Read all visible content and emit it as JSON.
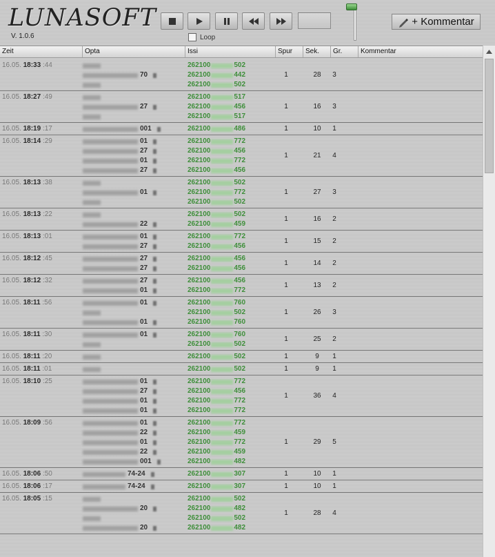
{
  "app": {
    "logo": "LUNASOFT",
    "version": "V. 1.0.6"
  },
  "toolbar": {
    "buttons": [
      {
        "name": "stop-button",
        "icon": "stop-icon"
      },
      {
        "name": "play-button",
        "icon": "play-icon"
      },
      {
        "name": "pause-button",
        "icon": "pause-icon"
      },
      {
        "name": "rewind-button",
        "icon": "rewind-icon"
      },
      {
        "name": "forward-button",
        "icon": "forward-icon"
      }
    ],
    "counter_value": "",
    "loop_label": "Loop",
    "loop_checked": false,
    "volume_level": 0.95,
    "comment_label": "+ Kommentar"
  },
  "table": {
    "columns": [
      "Zeit",
      "Opta",
      "Issi",
      "Spur",
      "Sek.",
      "Gr.",
      "Kommentar"
    ],
    "rows": [
      {
        "date": "16.05.",
        "time": "18:33",
        "sec": ":44",
        "spur": "1",
        "sek": "28",
        "gr": "3",
        "opta": [
          {
            "text": "Luna",
            "suffix": ""
          },
          {
            "text": "",
            "suffix": "70"
          },
          {
            "text": "Luna",
            "suffix": ""
          }
        ],
        "issi": [
          {
            "prefix": "262100",
            "suffix": "502"
          },
          {
            "prefix": "262100",
            "suffix": "442"
          },
          {
            "prefix": "262100",
            "suffix": "502"
          }
        ]
      },
      {
        "date": "16.05.",
        "time": "18:27",
        "sec": ":49",
        "spur": "1",
        "sek": "16",
        "gr": "3",
        "opta": [
          {
            "text": "Luna",
            "suffix": ""
          },
          {
            "text": "",
            "suffix": "27"
          },
          {
            "text": "Luna",
            "suffix": ""
          }
        ],
        "issi": [
          {
            "prefix": "262100",
            "suffix": "517"
          },
          {
            "prefix": "262100",
            "suffix": "456"
          },
          {
            "prefix": "262100",
            "suffix": "517"
          }
        ]
      },
      {
        "date": "16.05.",
        "time": "18:19",
        "sec": ":17",
        "spur": "1",
        "sek": "10",
        "gr": "1",
        "opta": [
          {
            "text": "",
            "suffix": "001"
          }
        ],
        "issi": [
          {
            "prefix": "262100",
            "suffix": "486"
          }
        ]
      },
      {
        "date": "16.05.",
        "time": "18:14",
        "sec": ":29",
        "spur": "1",
        "sek": "21",
        "gr": "4",
        "opta": [
          {
            "text": "",
            "suffix": "01"
          },
          {
            "text": "",
            "suffix": "27"
          },
          {
            "text": "",
            "suffix": "01"
          },
          {
            "text": "",
            "suffix": "27"
          }
        ],
        "issi": [
          {
            "prefix": "262100",
            "suffix": "772"
          },
          {
            "prefix": "262100",
            "suffix": "456"
          },
          {
            "prefix": "262100",
            "suffix": "772"
          },
          {
            "prefix": "262100",
            "suffix": "456"
          }
        ]
      },
      {
        "date": "16.05.",
        "time": "18:13",
        "sec": ":38",
        "spur": "1",
        "sek": "27",
        "gr": "3",
        "opta": [
          {
            "text": "Luna",
            "suffix": ""
          },
          {
            "text": "",
            "suffix": "01"
          },
          {
            "text": "Luna",
            "suffix": ""
          }
        ],
        "issi": [
          {
            "prefix": "262100",
            "suffix": "502"
          },
          {
            "prefix": "262100",
            "suffix": "772"
          },
          {
            "prefix": "262100",
            "suffix": "502"
          }
        ]
      },
      {
        "date": "16.05.",
        "time": "18:13",
        "sec": ":22",
        "spur": "1",
        "sek": "16",
        "gr": "2",
        "opta": [
          {
            "text": "Luna",
            "suffix": ""
          },
          {
            "text": "",
            "suffix": "22"
          }
        ],
        "issi": [
          {
            "prefix": "262100",
            "suffix": "502"
          },
          {
            "prefix": "262100",
            "suffix": "459"
          }
        ]
      },
      {
        "date": "16.05.",
        "time": "18:13",
        "sec": ":01",
        "spur": "1",
        "sek": "15",
        "gr": "2",
        "opta": [
          {
            "text": "",
            "suffix": "01"
          },
          {
            "text": "",
            "suffix": "27"
          }
        ],
        "issi": [
          {
            "prefix": "262100",
            "suffix": "772"
          },
          {
            "prefix": "262100",
            "suffix": "456"
          }
        ]
      },
      {
        "date": "16.05.",
        "time": "18:12",
        "sec": ":45",
        "spur": "1",
        "sek": "14",
        "gr": "2",
        "opta": [
          {
            "text": "",
            "suffix": "27"
          },
          {
            "text": "",
            "suffix": "27"
          }
        ],
        "issi": [
          {
            "prefix": "262100",
            "suffix": "456"
          },
          {
            "prefix": "262100",
            "suffix": "456"
          }
        ]
      },
      {
        "date": "16.05.",
        "time": "18:12",
        "sec": ":32",
        "spur": "1",
        "sek": "13",
        "gr": "2",
        "opta": [
          {
            "text": "",
            "suffix": "27"
          },
          {
            "text": "",
            "suffix": "01"
          }
        ],
        "issi": [
          {
            "prefix": "262100",
            "suffix": "456"
          },
          {
            "prefix": "262100",
            "suffix": "772"
          }
        ]
      },
      {
        "date": "16.05.",
        "time": "18:11",
        "sec": ":56",
        "spur": "1",
        "sek": "26",
        "gr": "3",
        "opta": [
          {
            "text": "",
            "suffix": "01"
          },
          {
            "text": "Luna",
            "suffix": ""
          },
          {
            "text": "",
            "suffix": "01"
          }
        ],
        "issi": [
          {
            "prefix": "262100",
            "suffix": "760"
          },
          {
            "prefix": "262100",
            "suffix": "502"
          },
          {
            "prefix": "262100",
            "suffix": "760"
          }
        ]
      },
      {
        "date": "16.05.",
        "time": "18:11",
        "sec": ":30",
        "spur": "1",
        "sek": "25",
        "gr": "2",
        "opta": [
          {
            "text": "",
            "suffix": "01"
          },
          {
            "text": "Luna",
            "suffix": ""
          }
        ],
        "issi": [
          {
            "prefix": "262100",
            "suffix": "760"
          },
          {
            "prefix": "262100",
            "suffix": "502"
          }
        ]
      },
      {
        "date": "16.05.",
        "time": "18:11",
        "sec": ":20",
        "spur": "1",
        "sek": "9",
        "gr": "1",
        "opta": [
          {
            "text": "Luna",
            "suffix": ""
          }
        ],
        "issi": [
          {
            "prefix": "262100",
            "suffix": "502"
          }
        ]
      },
      {
        "date": "16.05.",
        "time": "18:11",
        "sec": ":01",
        "spur": "1",
        "sek": "9",
        "gr": "1",
        "opta": [
          {
            "text": "Luna",
            "suffix": ""
          }
        ],
        "issi": [
          {
            "prefix": "262100",
            "suffix": "502"
          }
        ]
      },
      {
        "date": "16.05.",
        "time": "18:10",
        "sec": ":25",
        "spur": "1",
        "sek": "36",
        "gr": "4",
        "opta": [
          {
            "text": "",
            "suffix": "01"
          },
          {
            "text": "",
            "suffix": "27"
          },
          {
            "text": "",
            "suffix": "01"
          },
          {
            "text": "",
            "suffix": "01"
          }
        ],
        "issi": [
          {
            "prefix": "262100",
            "suffix": "772"
          },
          {
            "prefix": "262100",
            "suffix": "456"
          },
          {
            "prefix": "262100",
            "suffix": "772"
          },
          {
            "prefix": "262100",
            "suffix": "772"
          }
        ]
      },
      {
        "date": "16.05.",
        "time": "18:09",
        "sec": ":56",
        "spur": "1",
        "sek": "29",
        "gr": "5",
        "opta": [
          {
            "text": "",
            "suffix": "01"
          },
          {
            "text": "",
            "suffix": "22"
          },
          {
            "text": "",
            "suffix": "01"
          },
          {
            "text": "",
            "suffix": "22"
          },
          {
            "text": "",
            "suffix": "001"
          }
        ],
        "issi": [
          {
            "prefix": "262100",
            "suffix": "772"
          },
          {
            "prefix": "262100",
            "suffix": "459"
          },
          {
            "prefix": "262100",
            "suffix": "772"
          },
          {
            "prefix": "262100",
            "suffix": "459"
          },
          {
            "prefix": "262100",
            "suffix": "482"
          }
        ]
      },
      {
        "date": "16.05.",
        "time": "18:06",
        "sec": ":50",
        "spur": "1",
        "sek": "10",
        "gr": "1",
        "opta": [
          {
            "text": "",
            "suffix": "74-24"
          }
        ],
        "issi": [
          {
            "prefix": "262100",
            "suffix": "307"
          }
        ]
      },
      {
        "date": "16.05.",
        "time": "18:06",
        "sec": ":17",
        "spur": "1",
        "sek": "10",
        "gr": "1",
        "opta": [
          {
            "text": "",
            "suffix": "74-24"
          }
        ],
        "issi": [
          {
            "prefix": "262100",
            "suffix": "307"
          }
        ]
      },
      {
        "date": "16.05.",
        "time": "18:05",
        "sec": ":15",
        "spur": "1",
        "sek": "28",
        "gr": "4",
        "opta": [
          {
            "text": "Luna",
            "suffix": ""
          },
          {
            "text": "",
            "suffix": "20"
          },
          {
            "text": "Luna",
            "suffix": ""
          },
          {
            "text": "",
            "suffix": "20"
          }
        ],
        "issi": [
          {
            "prefix": "262100",
            "suffix": "502"
          },
          {
            "prefix": "262100",
            "suffix": "482"
          },
          {
            "prefix": "262100",
            "suffix": "502"
          },
          {
            "prefix": "262100",
            "suffix": "482"
          }
        ]
      }
    ]
  }
}
